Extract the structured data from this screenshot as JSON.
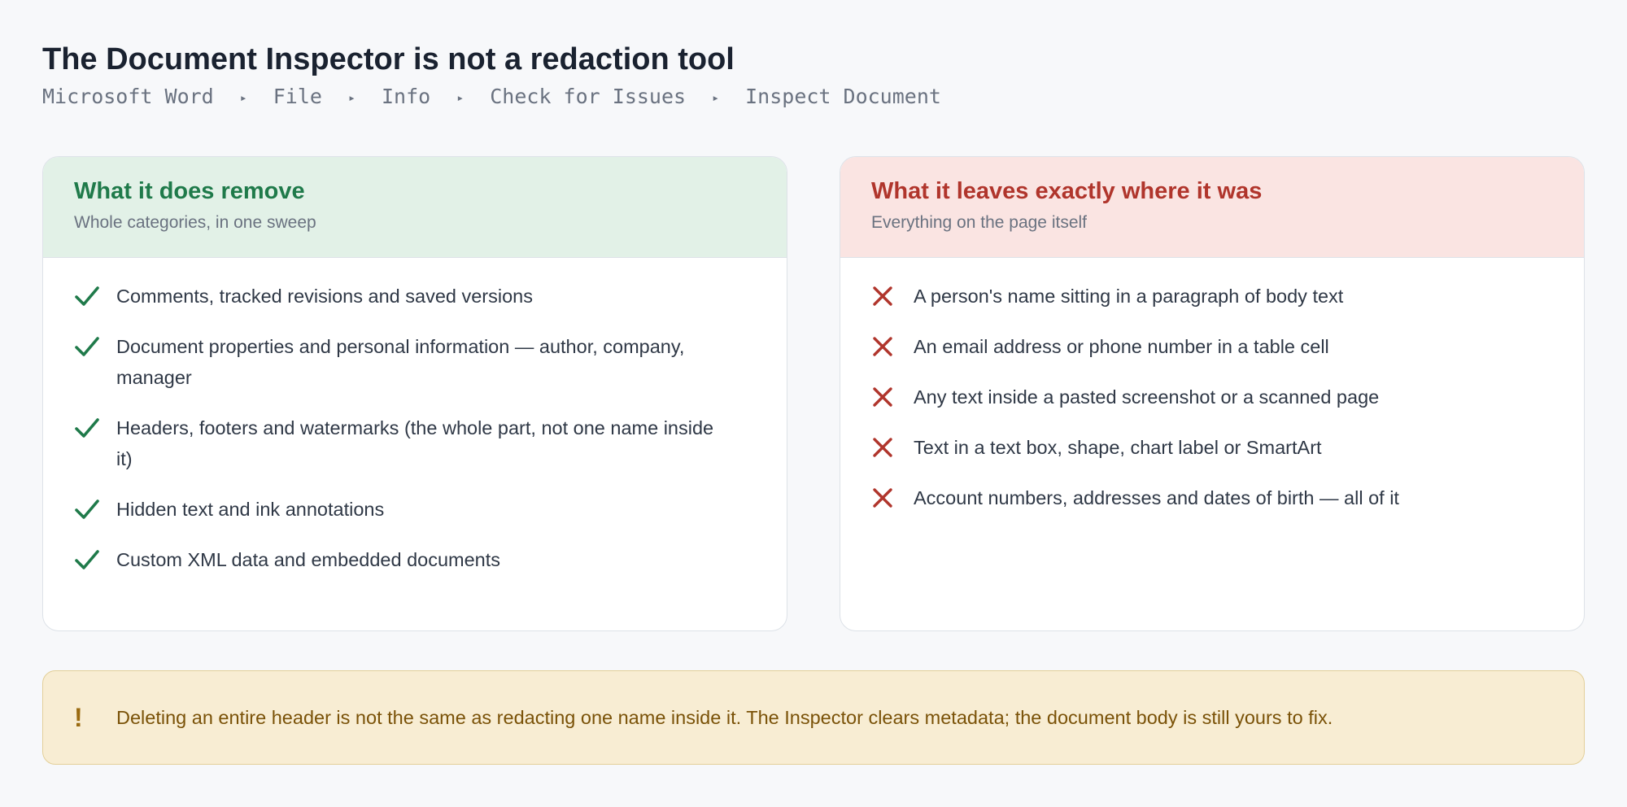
{
  "header": {
    "title": "The Document Inspector is not a redaction tool",
    "breadcrumb": [
      "Microsoft Word",
      "File",
      "Info",
      "Check for Issues",
      "Inspect Document"
    ],
    "separator": "▸"
  },
  "removes": {
    "title": "What it does remove",
    "subtitle": "Whole categories, in one sweep",
    "icon": "check-icon",
    "color": "#1f7a4a",
    "items": [
      "Comments, tracked revisions and saved versions",
      "Document properties and personal information — author, company, manager",
      "Headers, footers and watermarks (the whole part, not one name inside it)",
      "Hidden text and ink annotations",
      "Custom XML data and embedded documents"
    ]
  },
  "leaves": {
    "title": "What it leaves exactly where it was",
    "subtitle": "Everything on the page itself",
    "icon": "cross-icon",
    "color": "#b0352c",
    "items": [
      "A person's name sitting in a paragraph of body text",
      "An email address or phone number in a table cell",
      "Any text inside a pasted screenshot or a scanned page",
      "Text in a text box, shape, chart label or SmartArt",
      "Account numbers, addresses and dates of birth — all of it"
    ]
  },
  "callout": {
    "icon": "exclamation-icon",
    "mark": "!",
    "text": "Deleting an entire header is not the same as redacting one name inside it. The Inspector clears metadata; the document body is still yours to fix."
  }
}
